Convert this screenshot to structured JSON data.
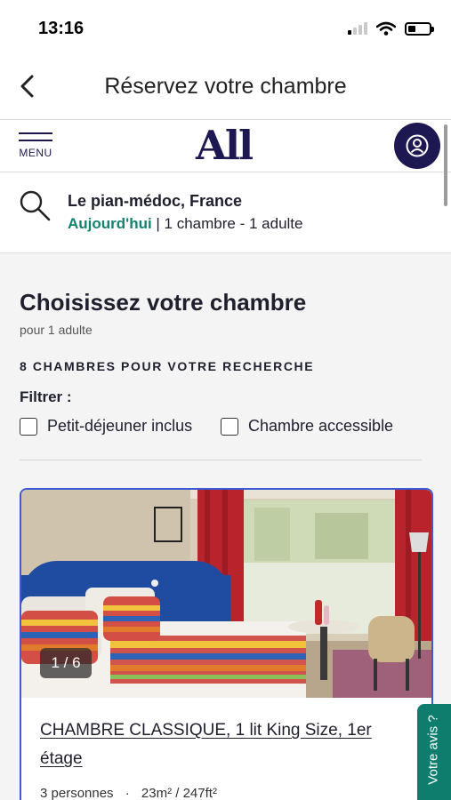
{
  "status": {
    "time": "13:16"
  },
  "header": {
    "title": "Réservez votre chambre"
  },
  "site": {
    "menu_label": "MENU",
    "logo": "All"
  },
  "search": {
    "destination": "Le pian-médoc, France",
    "date": "Aujourd'hui",
    "details": " | 1 chambre - 1 adulte"
  },
  "main": {
    "title": "Choisissez votre chambre",
    "subtitle": "pour 1 adulte",
    "result_count": "8 CHAMBRES POUR VOTRE RECHERCHE",
    "filter_label": "Filtrer :",
    "filters": [
      {
        "label": "Petit-déjeuner inclus",
        "checked": false
      },
      {
        "label": "Chambre accessible",
        "checked": false
      }
    ]
  },
  "room": {
    "photo_counter": "1 / 6",
    "title": "CHAMBRE CLASSIQUE, 1 lit King Size, 1er étage",
    "capacity": "3 personnes",
    "separator": "·",
    "size": "23m² / 247ft²"
  },
  "feedback": {
    "label": "Votre avis ?"
  },
  "colors": {
    "brand": "#1e1852",
    "accent_green": "#128271",
    "card_border": "#3c5ad6",
    "feedback_bg": "#0f7d6e"
  },
  "icons": [
    "back-arrow-icon",
    "signal-icon",
    "wifi-icon",
    "battery-icon",
    "menu-icon",
    "account-icon",
    "search-icon",
    "checkbox-icon"
  ]
}
